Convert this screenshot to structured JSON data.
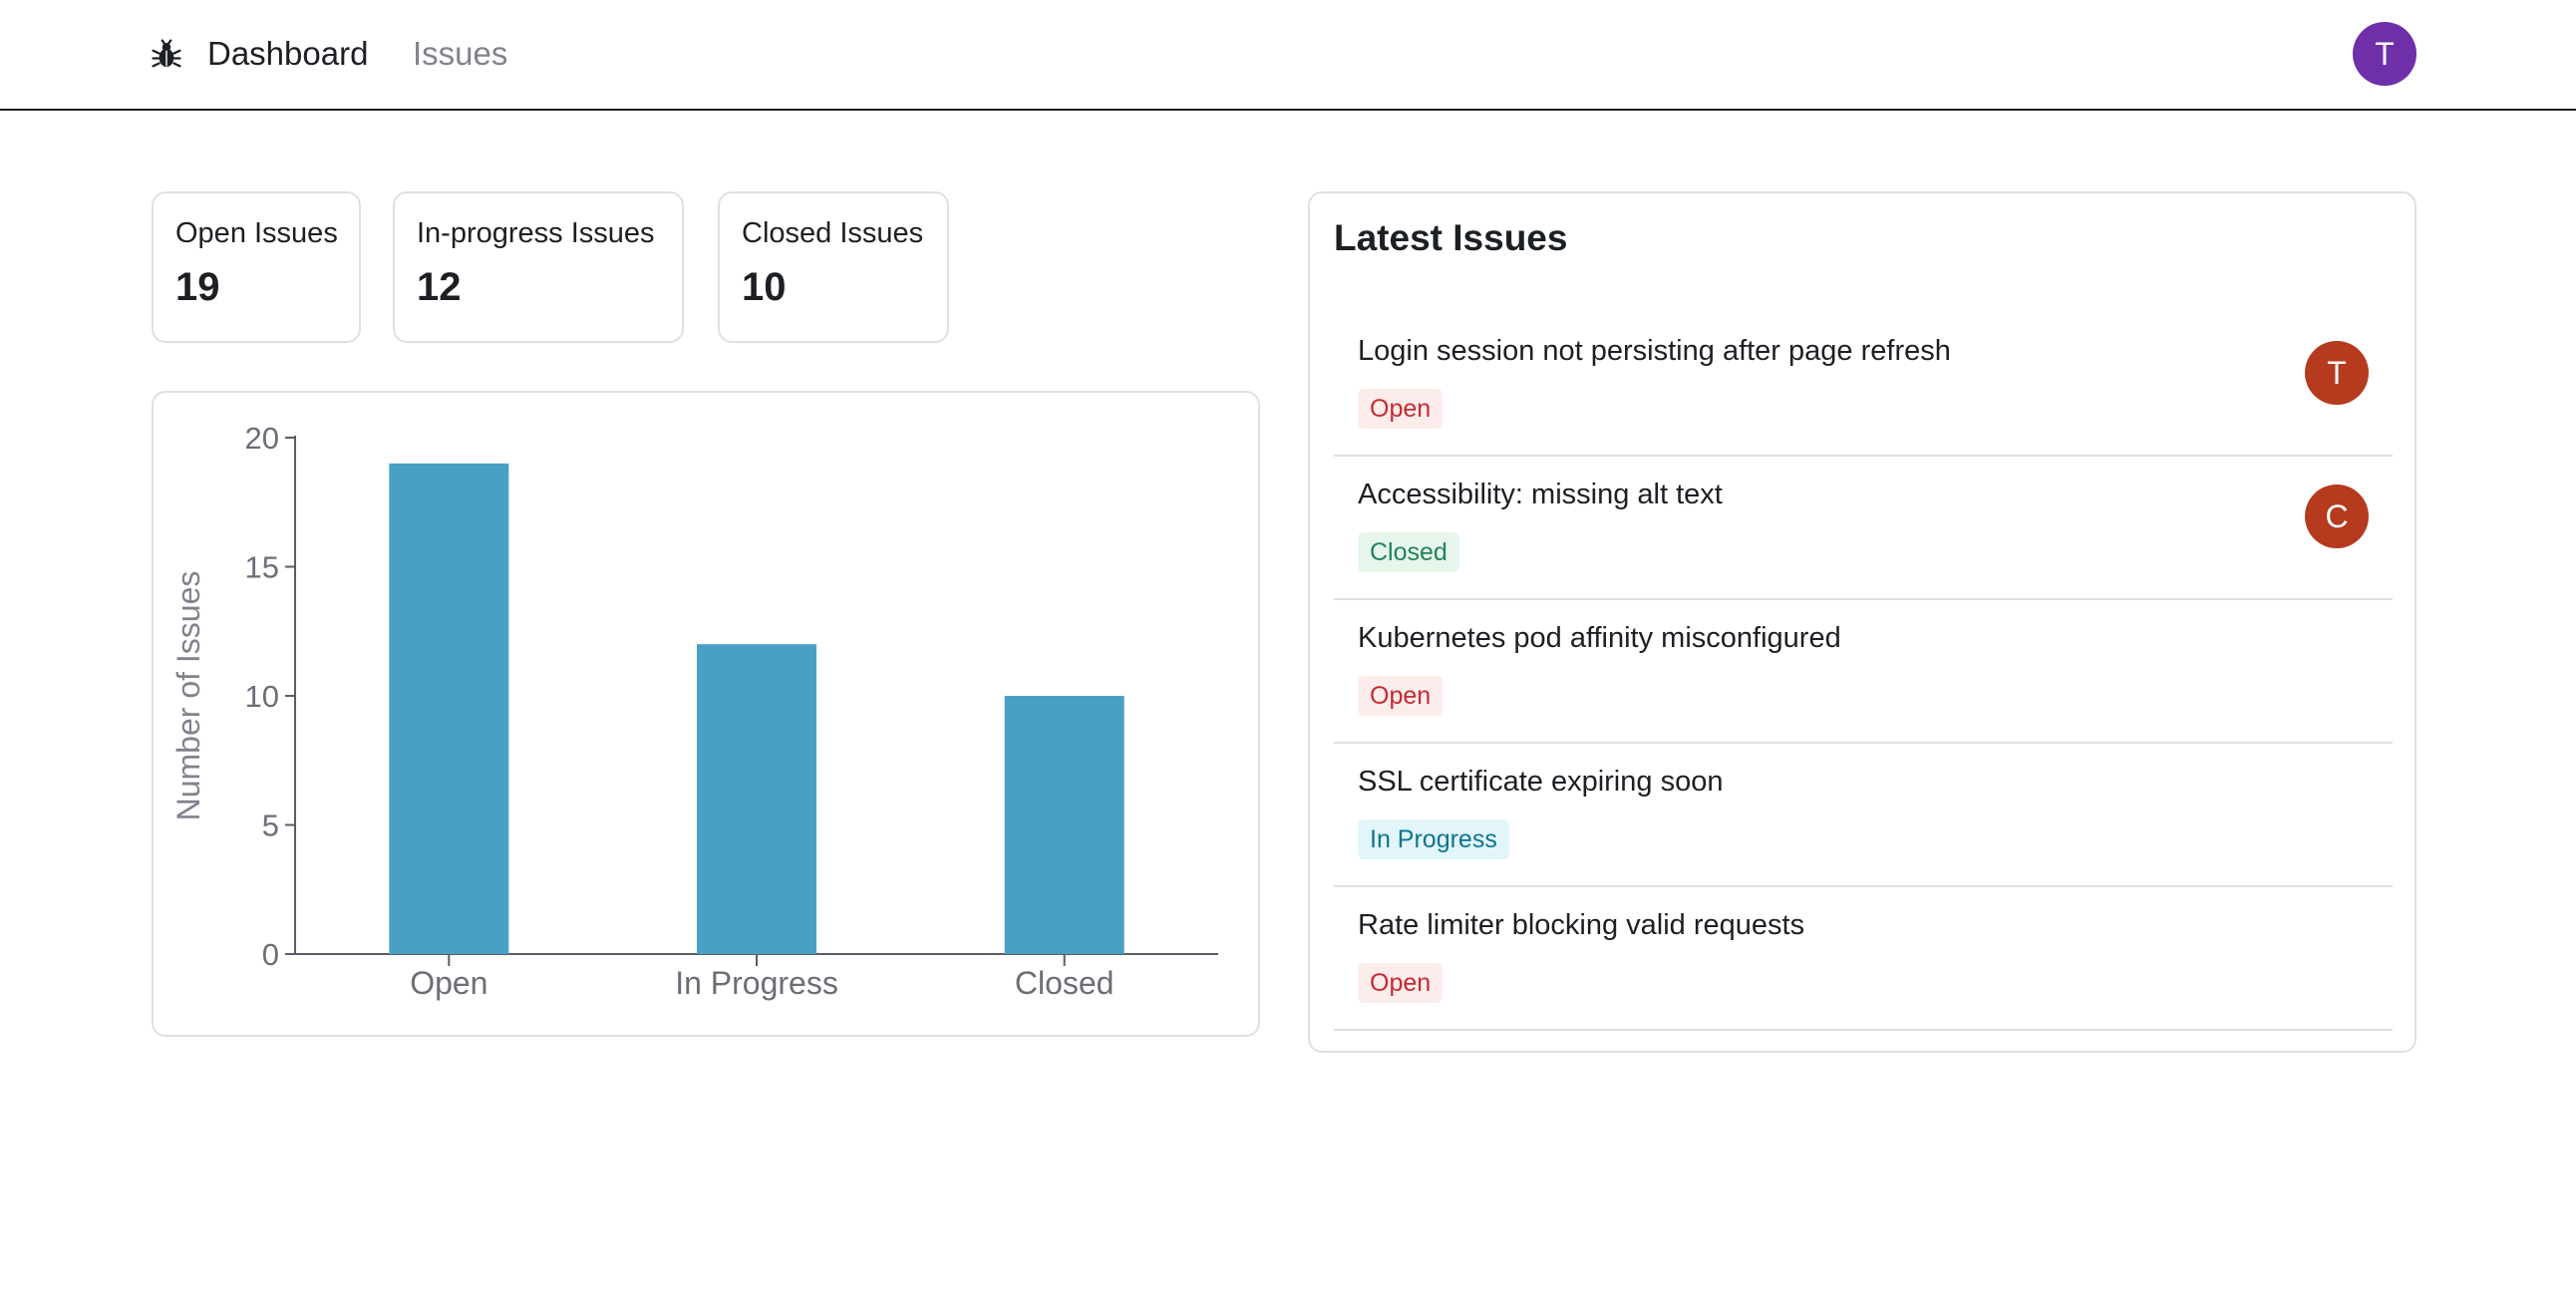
{
  "nav": {
    "brand_icon": "bug-icon",
    "dashboard_label": "Dashboard",
    "issues_label": "Issues",
    "user_initial": "T",
    "user_avatar_color": "#6e2fa8"
  },
  "stats": [
    {
      "label": "Open Issues",
      "value": "19"
    },
    {
      "label": "In-progress Issues",
      "value": "12"
    },
    {
      "label": "Closed Issues",
      "value": "10"
    }
  ],
  "chart_data": {
    "type": "bar",
    "categories": [
      "Open",
      "In Progress",
      "Closed"
    ],
    "values": [
      19,
      12,
      10
    ],
    "title": "",
    "xlabel": "",
    "ylabel": "Number of Issues",
    "ylim": [
      0,
      20
    ],
    "yticks": [
      0,
      5,
      10,
      15,
      20
    ],
    "bar_color": "#48a1c4",
    "grid": false
  },
  "latest": {
    "title": "Latest Issues",
    "issues": [
      {
        "title": "Login session not persisting after page refresh",
        "status": "Open",
        "status_key": "open",
        "assignee": "T"
      },
      {
        "title": "Accessibility: missing alt text",
        "status": "Closed",
        "status_key": "closed",
        "assignee": "C"
      },
      {
        "title": "Kubernetes pod affinity misconfigured",
        "status": "Open",
        "status_key": "open",
        "assignee": ""
      },
      {
        "title": "SSL certificate expiring soon",
        "status": "In Progress",
        "status_key": "progress",
        "assignee": ""
      },
      {
        "title": "Rate limiter blocking valid requests",
        "status": "Open",
        "status_key": "open",
        "assignee": ""
      }
    ],
    "assignee_color": "#b53a1e"
  }
}
